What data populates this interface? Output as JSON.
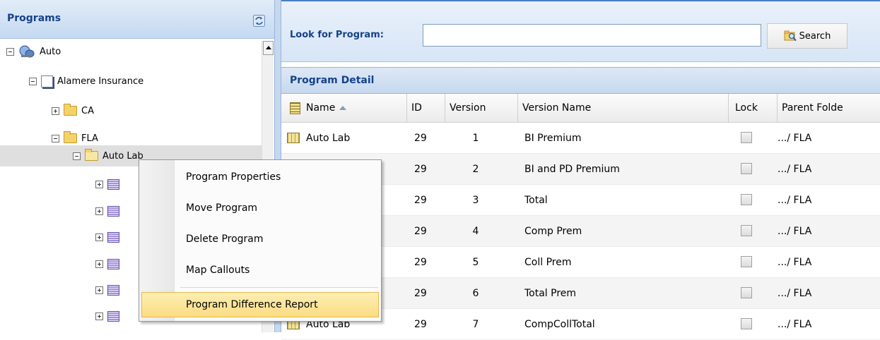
{
  "programs_panel": {
    "title": "Programs",
    "tree": {
      "root_label": "Auto",
      "company_label": "Alamere Insurance",
      "folders": [
        "CA",
        "FLA"
      ],
      "selected_program_label": "Auto Lab"
    }
  },
  "search": {
    "label": "Look for Program:",
    "input_value": "",
    "button_label": "Search"
  },
  "program_detail": {
    "title": "Program Detail",
    "columns": [
      "Name",
      "ID",
      "Version",
      "Version Name",
      "Lock",
      "Parent Folde"
    ],
    "rows": [
      {
        "name": "Auto Lab",
        "id": "29",
        "version": "1",
        "version_name": "BI Premium",
        "parent": ".../ FLA"
      },
      {
        "name": "",
        "id": "29",
        "version": "2",
        "version_name": "BI and PD Premium",
        "parent": ".../ FLA"
      },
      {
        "name": "",
        "id": "29",
        "version": "3",
        "version_name": "Total",
        "parent": ".../ FLA"
      },
      {
        "name": "",
        "id": "29",
        "version": "4",
        "version_name": "Comp Prem",
        "parent": ".../ FLA"
      },
      {
        "name": "",
        "id": "29",
        "version": "5",
        "version_name": "Coll Prem",
        "parent": ".../ FLA"
      },
      {
        "name": "",
        "id": "29",
        "version": "6",
        "version_name": "Total Prem",
        "parent": ".../ FLA"
      },
      {
        "name": "Auto Lab",
        "id": "29",
        "version": "7",
        "version_name": "CompCollTotal",
        "parent": ".../ FLA"
      }
    ]
  },
  "context_menu": {
    "items": [
      "Program Properties",
      "Move Program",
      "Delete Program",
      "Map Callouts",
      "Program Difference Report"
    ]
  },
  "colors": {
    "header_text": "#15428b",
    "highlight": "#fbdc83"
  }
}
